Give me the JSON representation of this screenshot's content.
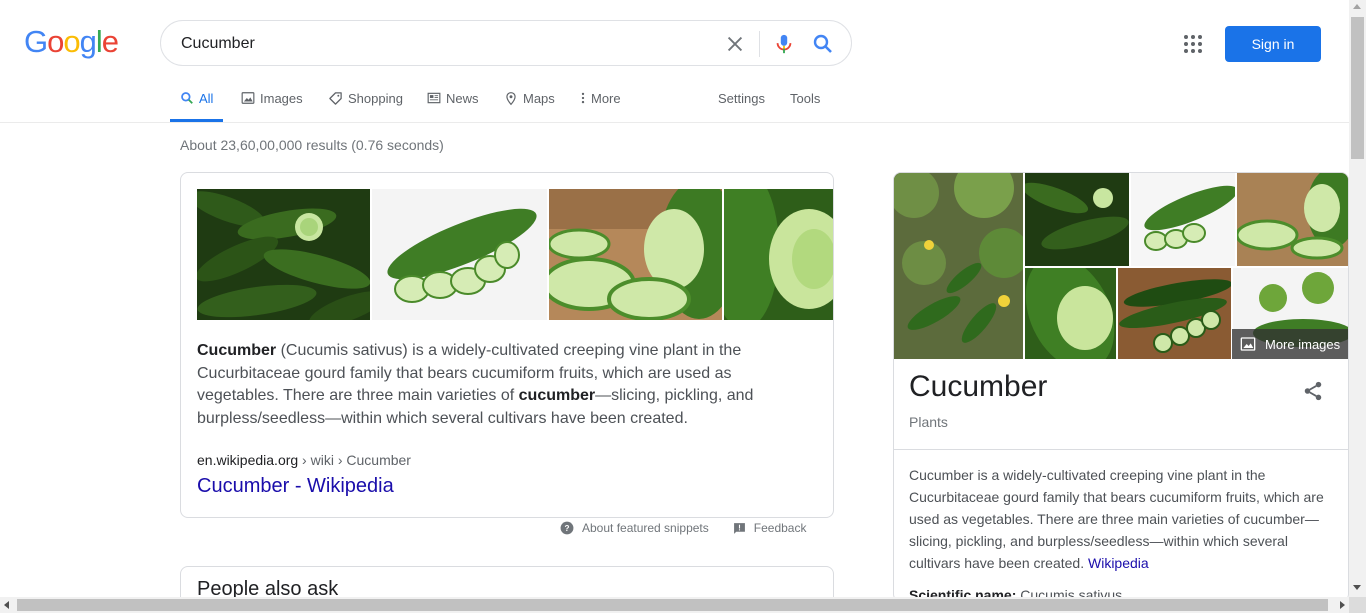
{
  "logo": {
    "letters": [
      "G",
      "o",
      "o",
      "g",
      "l",
      "e"
    ]
  },
  "search": {
    "query": "Cucumber",
    "clear_icon": "close-icon",
    "voice_icon": "mic-icon",
    "submit_icon": "search-icon"
  },
  "header": {
    "apps_icon": "apps-grid-icon",
    "sign_in_label": "Sign in",
    "accent_color": "#1a73e8"
  },
  "tabs": [
    {
      "label": "All",
      "icon": "search-icon",
      "active": true
    },
    {
      "label": "Images",
      "icon": "image-icon",
      "active": false
    },
    {
      "label": "Shopping",
      "icon": "tag-icon",
      "active": false
    },
    {
      "label": "News",
      "icon": "news-icon",
      "active": false
    },
    {
      "label": "Maps",
      "icon": "map-pin-icon",
      "active": false
    },
    {
      "label": "More",
      "icon": "more-vert-icon",
      "active": false
    }
  ],
  "tools": {
    "settings_label": "Settings",
    "tools_label": "Tools"
  },
  "stats": "About 23,60,00,000 results (0.76 seconds)",
  "snippet": {
    "term": "Cucumber",
    "text_1": " (Cucumis sativus) is a widely-cultivated creeping vine plant in the Cucurbitaceae gourd family that bears cucumiform fruits, which are used as vegetables. There are three main varieties of ",
    "term_2": "cucumber",
    "text_2": "—slicing, pickling, and burpless/seedless—within which several cultivars have been created.",
    "source_domain": "en.wikipedia.org",
    "source_path": " › wiki › Cucumber",
    "link_title": "Cucumber - Wikipedia",
    "footer_about": "About featured snippets",
    "footer_feedback": "Feedback"
  },
  "people_also_ask": {
    "title": "People also ask"
  },
  "knowledge_panel": {
    "title": "Cucumber",
    "subtitle": "Plants",
    "more_images": "More images",
    "share_icon": "share-icon",
    "description": "Cucumber is a widely-cultivated creeping vine plant in the Cucurbitaceae gourd family that bears cucumiform fruits, which are used as vegetables. There are three main varieties of cucumber—slicing, pickling, and burpless/seedless—within which several cultivars have been created. ",
    "source_link": "Wikipedia",
    "fact_label": "Scientific name:",
    "fact_value": " Cucumis sativus"
  }
}
